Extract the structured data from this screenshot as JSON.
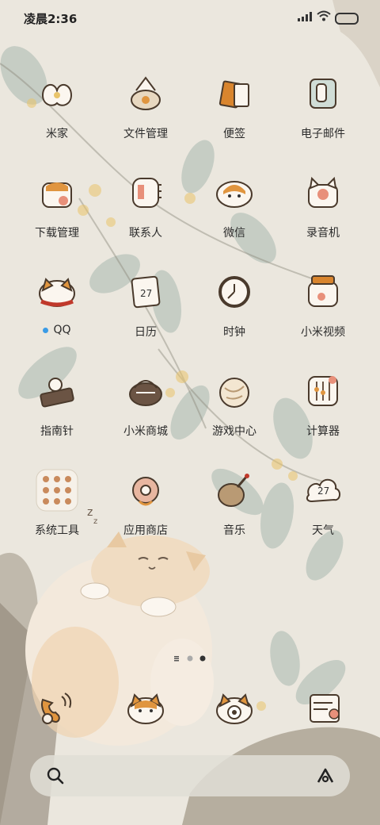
{
  "status_bar": {
    "time": "凌晨2:36"
  },
  "apps": [
    {
      "label": "米家",
      "icon": "mijia-flower-icon"
    },
    {
      "label": "文件管理",
      "icon": "file-manager-basket-icon"
    },
    {
      "label": "便签",
      "icon": "notes-tag-icon"
    },
    {
      "label": "电子邮件",
      "icon": "email-cup-icon"
    },
    {
      "label": "下载管理",
      "icon": "download-cat-icon"
    },
    {
      "label": "联系人",
      "icon": "contacts-book-icon"
    },
    {
      "label": "微信",
      "icon": "wechat-cat-icon"
    },
    {
      "label": "录音机",
      "icon": "recorder-cat-icon"
    },
    {
      "label": "QQ",
      "icon": "qq-cat-icon"
    },
    {
      "label": "日历",
      "icon": "calendar-icon",
      "text": "27"
    },
    {
      "label": "时钟",
      "icon": "clock-icon"
    },
    {
      "label": "小米视频",
      "icon": "video-jar-icon"
    },
    {
      "label": "指南针",
      "icon": "compass-tray-icon"
    },
    {
      "label": "小米商城",
      "icon": "mall-basket-icon"
    },
    {
      "label": "游戏中心",
      "icon": "game-ball-icon"
    },
    {
      "label": "计算器",
      "icon": "calculator-abacus-icon"
    },
    {
      "label": "系统工具",
      "icon": "system-tools-folder-icon"
    },
    {
      "label": "应用商店",
      "icon": "app-store-donut-icon"
    },
    {
      "label": "音乐",
      "icon": "music-pipa-icon"
    },
    {
      "label": "天气",
      "icon": "weather-cloud-icon",
      "text": "27"
    }
  ],
  "dock": [
    {
      "icon": "phone-icon"
    },
    {
      "icon": "messages-cat-icon"
    },
    {
      "icon": "camera-cat-icon"
    },
    {
      "icon": "browser-scroll-icon"
    }
  ],
  "pager": {
    "current": 3,
    "total": 3
  },
  "colors": {
    "accent": "#e0953f",
    "new_dot": "#3a9be6",
    "bg": "#ece8df"
  }
}
